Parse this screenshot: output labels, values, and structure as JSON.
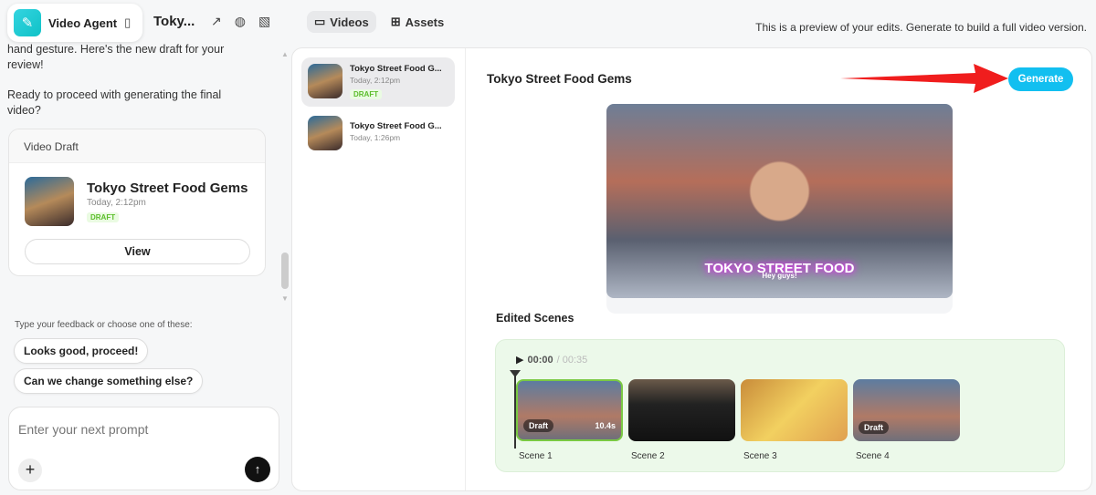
{
  "header": {
    "app_name": "Video Agent",
    "project_title": "Toky...",
    "note": "This is a preview of your edits. Generate to build a full video version.",
    "tabs": [
      {
        "label": "Videos",
        "active": true
      },
      {
        "label": "Assets",
        "active": false
      }
    ]
  },
  "chat": {
    "message_1": "hand gesture. Here's the new draft for your review!",
    "message_2": "Ready to proceed with generating the final video?",
    "card": {
      "header": "Video Draft",
      "title": "Tokyo Street Food Gems",
      "time": "Today, 2:12pm",
      "badge": "DRAFT",
      "view": "View"
    },
    "suggest_label": "Type your feedback or choose one of these:",
    "chips": [
      "Looks good, proceed!",
      "Can we change something else?"
    ],
    "prompt_placeholder": "Enter your next prompt"
  },
  "videos": [
    {
      "title": "Tokyo Street Food G...",
      "time": "Today, 2:12pm",
      "badge": "DRAFT"
    },
    {
      "title": "Tokyo Street Food G...",
      "time": "Today, 1:26pm"
    }
  ],
  "preview": {
    "title": "Tokyo Street Food Gems",
    "generate": "Generate",
    "overlay_title": "TOKYO STREET FOOD",
    "caption": "Hey guys!",
    "edited_scenes": "Edited Scenes",
    "time_current": "00:00",
    "time_total": "/ 00:35",
    "scenes": [
      {
        "name": "Scene 1",
        "badge": "Draft",
        "duration": "10.4s"
      },
      {
        "name": "Scene 2"
      },
      {
        "name": "Scene 3"
      },
      {
        "name": "Scene 4",
        "badge": "Draft"
      }
    ]
  },
  "colors": {
    "accent": "#12bff0",
    "draft": "#5bbd2a",
    "arrow": "#f01d1d"
  }
}
